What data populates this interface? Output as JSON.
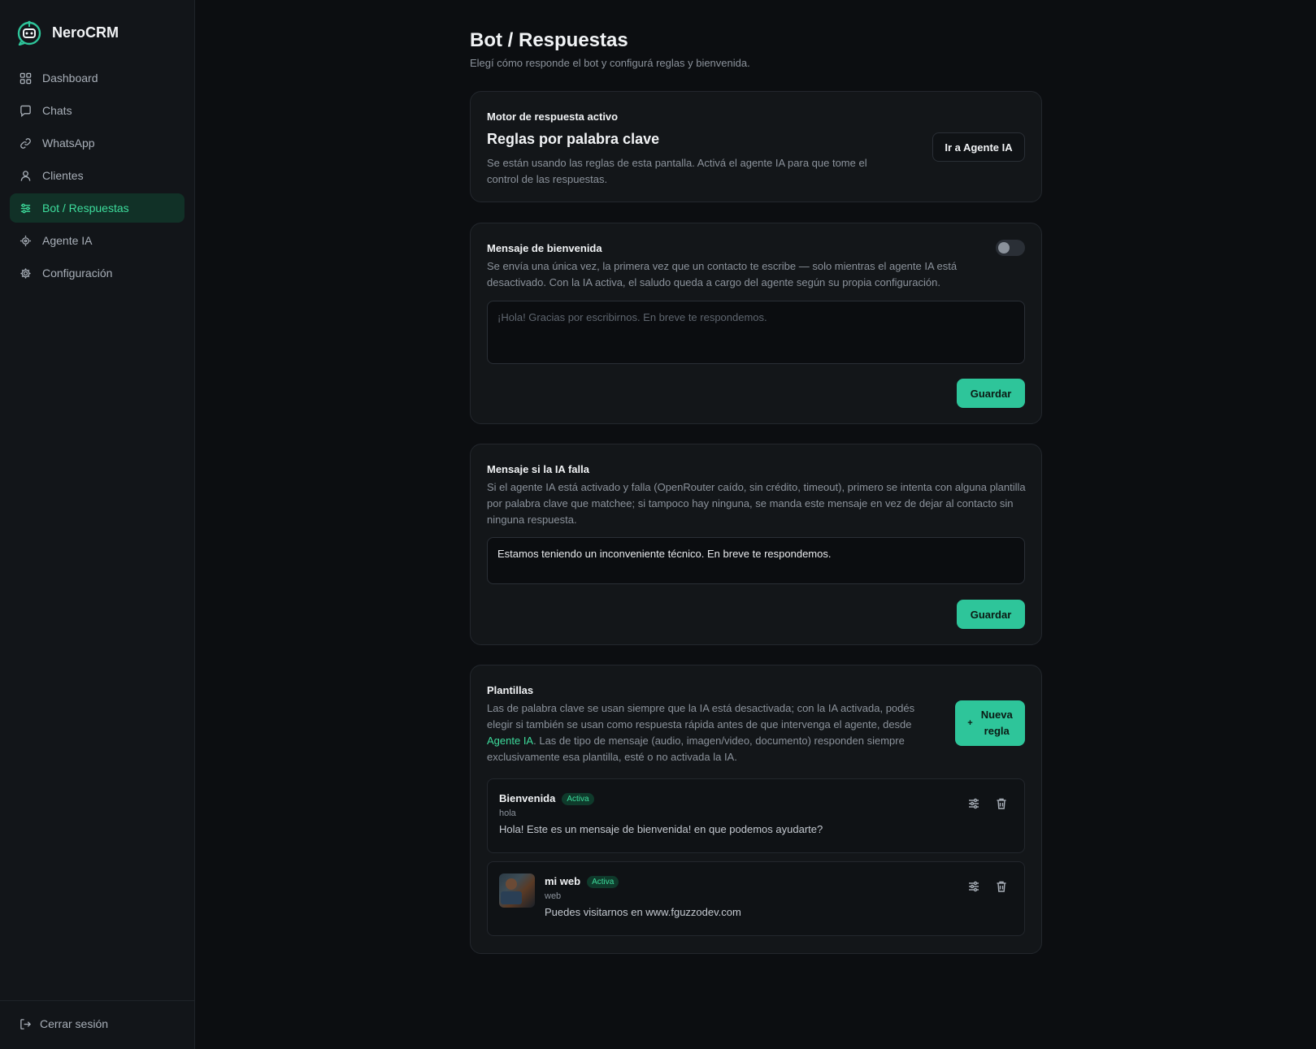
{
  "app": {
    "name": "NeroCRM"
  },
  "sidebar": {
    "items": [
      {
        "label": "Dashboard",
        "icon": "grid-icon"
      },
      {
        "label": "Chats",
        "icon": "chat-icon"
      },
      {
        "label": "WhatsApp",
        "icon": "link-icon"
      },
      {
        "label": "Clientes",
        "icon": "user-icon"
      },
      {
        "label": "Bot / Respuestas",
        "icon": "sliders-icon",
        "active": true
      },
      {
        "label": "Agente IA",
        "icon": "bot-icon"
      },
      {
        "label": "Configuración",
        "icon": "gear-icon"
      }
    ],
    "logout_label": "Cerrar sesión"
  },
  "page": {
    "title": "Bot / Respuestas",
    "subtitle": "Elegí cómo responde el bot y configurá reglas y bienvenida."
  },
  "engine": {
    "label": "Motor de respuesta activo",
    "title": "Reglas por palabra clave",
    "description": "Se están usando las reglas de esta pantalla. Activá el agente IA para que tome el control de las respuestas.",
    "button": "Ir a Agente IA"
  },
  "welcome": {
    "label": "Mensaje de bienvenida",
    "enabled": false,
    "description": "Se envía una única vez, la primera vez que un contacto te escribe — solo mientras el agente IA está desactivado. Con la IA activa, el saludo queda a cargo del agente según su propia configuración.",
    "placeholder": "¡Hola! Gracias por escribirnos. En breve te respondemos.",
    "value": "",
    "save": "Guardar"
  },
  "fallback": {
    "label": "Mensaje si la IA falla",
    "description": "Si el agente IA está activado y falla (OpenRouter caído, sin crédito, timeout), primero se intenta con alguna plantilla por palabra clave que matchee; si tampoco hay ninguna, se manda este mensaje en vez de dejar al contacto sin ninguna respuesta.",
    "value": "Estamos teniendo un inconveniente técnico. En breve te respondemos.",
    "save": "Guardar"
  },
  "templates": {
    "label": "Plantillas",
    "desc_part1": "Las de palabra clave se usan siempre que la IA está desactivada; con la IA activada, podés elegir si también se usan como respuesta rápida antes de que intervenga el agente, desde ",
    "desc_link": "Agente IA",
    "desc_part2": ". Las de tipo de mensaje (audio, imagen/video, documento) responden siempre exclusivamente esa plantilla, esté o no activada la IA.",
    "new_button_line1": "Nueva",
    "new_button_line2": "regla",
    "items": [
      {
        "name": "Bienvenida",
        "badge": "Activa",
        "keyword": "hola",
        "text": "Hola! Este es un mensaje de bienvenida! en que podemos ayudarte?",
        "has_image": false
      },
      {
        "name": "mi web",
        "badge": "Activa",
        "keyword": "web",
        "text": "Puedes visitarnos en www.fguzzodev.com",
        "has_image": true
      }
    ]
  },
  "colors": {
    "accent": "#2ec59a",
    "background": "#0c0e11",
    "sidebar": "#121519",
    "card": "#131619"
  }
}
